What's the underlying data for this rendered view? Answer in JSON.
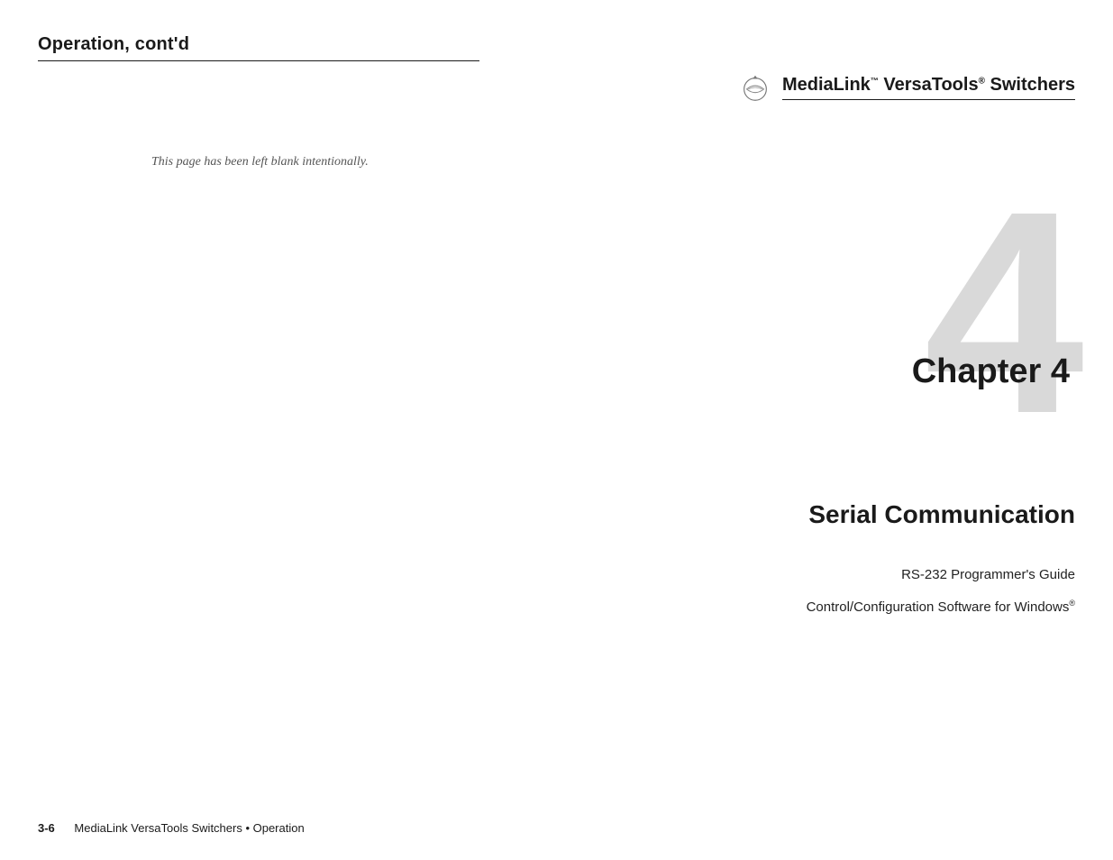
{
  "left": {
    "header_title": "Operation, cont'd",
    "blank_notice": "This page has been left blank intentionally.",
    "footer_page_number": "3-6",
    "footer_text": "MediaLink VersaTools Switchers • Operation"
  },
  "right": {
    "header_brand_medialink": "MediaLink",
    "header_brand_versatools": " VersaTools",
    "header_brand_switchers": " Switchers",
    "logo_icon_name": "extron-seal-icon",
    "chapter_number": "4",
    "chapter_label": "Chapter 4",
    "section_title": "Serial Communication",
    "sub_items": {
      "item1": "RS-232 Programmer's Guide",
      "item2_prefix": "Control/Configuration Software for Windows"
    }
  }
}
